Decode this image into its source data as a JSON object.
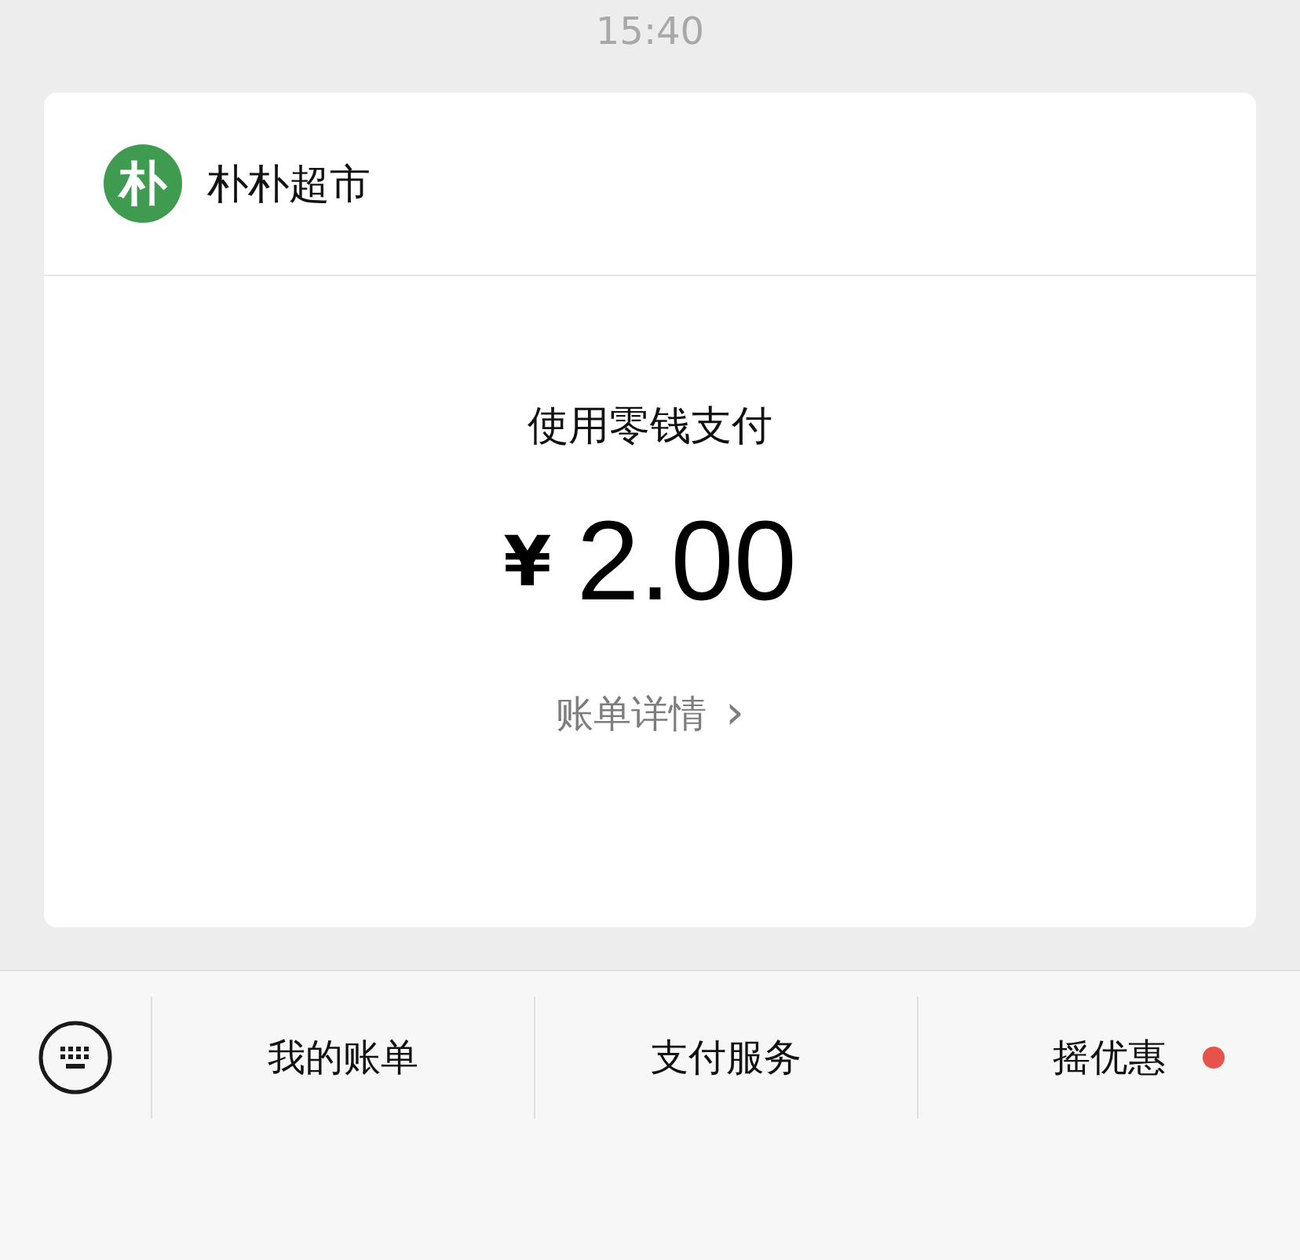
{
  "time": "15:40",
  "card": {
    "logo_text": "朴",
    "merchant": "朴朴超市",
    "payment_method": "使用零钱支付",
    "currency": "¥",
    "amount": "2.00",
    "details_link": "账单详情",
    "details_arrow": "›"
  },
  "menu": [
    {
      "label": "我的账单",
      "dot": false
    },
    {
      "label": "支付服务",
      "dot": false
    },
    {
      "label": "摇优惠",
      "dot": true
    }
  ]
}
